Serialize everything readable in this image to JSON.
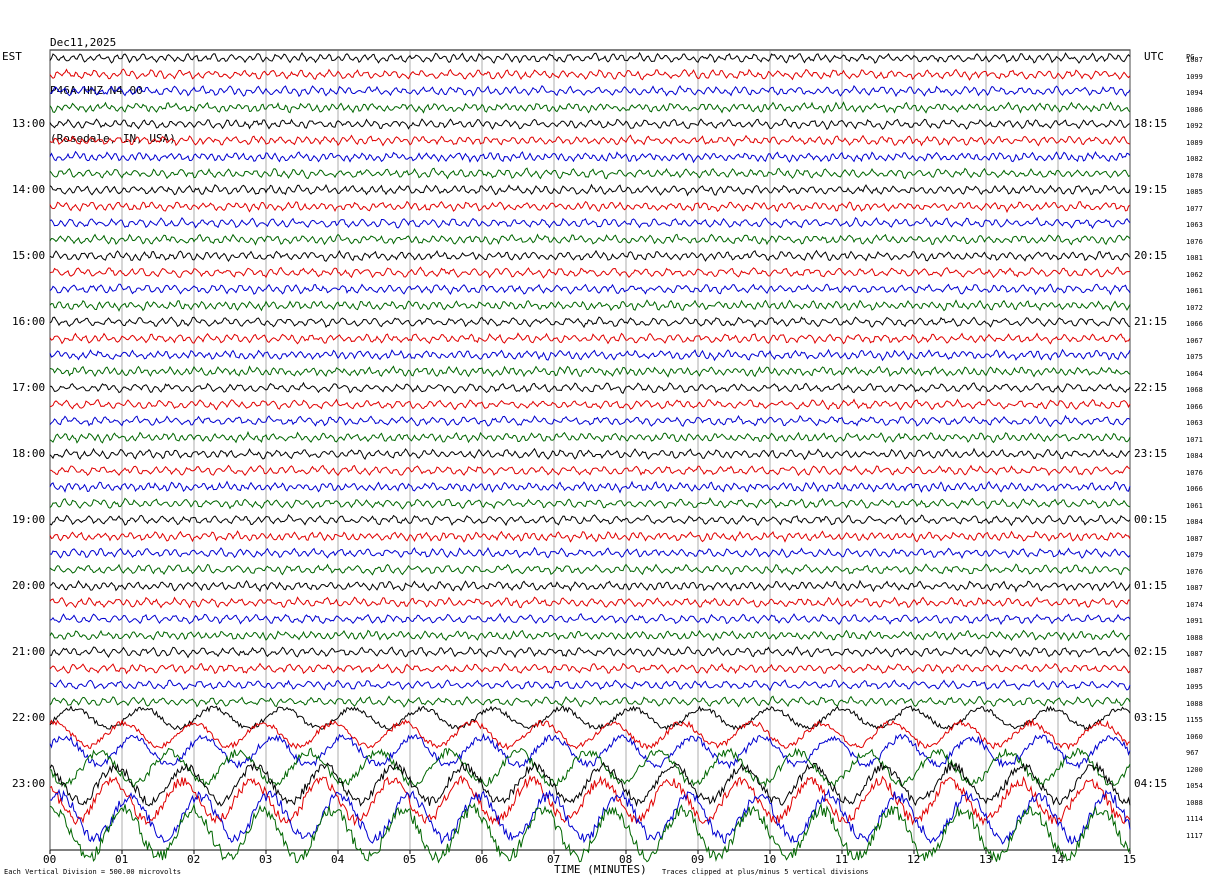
{
  "header": {
    "date": "Dec11,2025",
    "station": "P46A HHZ N4 00",
    "location": "(Rosedale, IN, USA)"
  },
  "left_tz": "EST",
  "right_tz": "UTC",
  "right_col_head": "PG",
  "footer": {
    "scale": "Each Vertical Division =  500.00 microvolts",
    "clip": "Traces clipped at plus/minus 5 vertical divisions",
    "xlabel": "TIME (MINUTES)"
  },
  "colors": [
    "#000000",
    "#e00000",
    "#0000d0",
    "#006600"
  ],
  "chart_data": {
    "type": "line",
    "xlabel": "TIME (MINUTES)",
    "xlim": [
      0,
      15
    ],
    "x_ticks": [
      "00",
      "01",
      "02",
      "03",
      "04",
      "05",
      "06",
      "07",
      "08",
      "09",
      "10",
      "11",
      "12",
      "13",
      "14",
      "15"
    ],
    "rows_per_hour": 4,
    "est_hour_labels": [
      "13:00",
      "14:00",
      "15:00",
      "16:00",
      "17:00",
      "18:00",
      "19:00",
      "20:00",
      "21:00",
      "22:00",
      "23:00"
    ],
    "utc_hour_labels": [
      "18:15",
      "19:15",
      "20:15",
      "21:15",
      "22:15",
      "23:15",
      "00:15",
      "01:15",
      "02:15",
      "03:15",
      "04:15"
    ],
    "row_values": [
      "1087",
      "1099",
      "1094",
      "1086",
      "1092",
      "1089",
      "1082",
      "1078",
      "1085",
      "1077",
      "1063",
      "1076",
      "1081",
      "1062",
      "1061",
      "1072",
      "1066",
      "1067",
      "1075",
      "1064",
      "1068",
      "1066",
      "1063",
      "1071",
      "1084",
      "1076",
      "1066",
      "1061",
      "1084",
      "1087",
      "1079",
      "1076",
      "1087",
      "1074",
      "1091",
      "1088",
      "1087",
      "1087",
      "1095",
      "1088",
      "1155",
      "1060",
      "967",
      "1200",
      "1054",
      "1088",
      "1114",
      "1117"
    ]
  }
}
